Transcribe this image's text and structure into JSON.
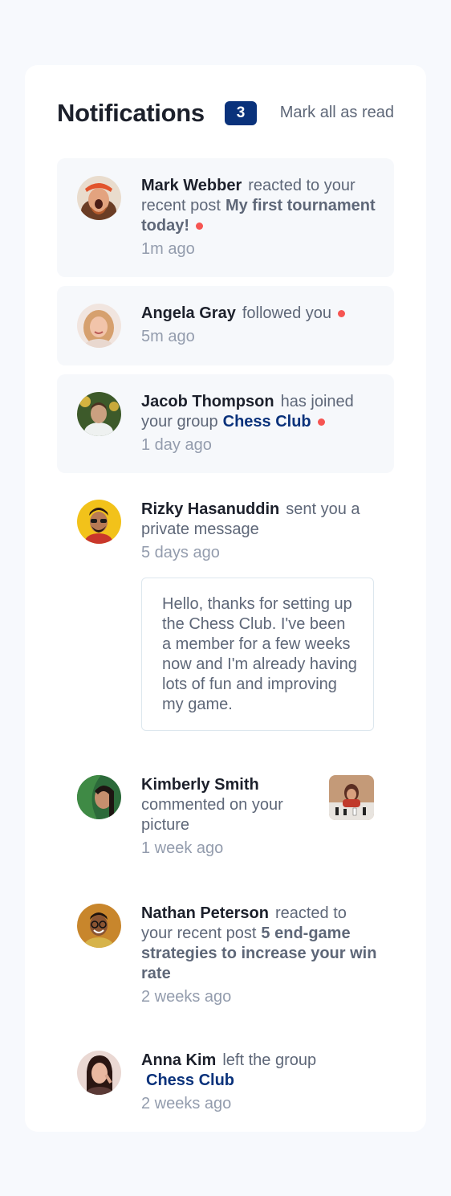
{
  "header": {
    "title": "Notifications",
    "badge_count": "3",
    "mark_all_label": "Mark all as read"
  },
  "notifications": [
    {
      "name": "Mark Webber",
      "action": "reacted to your recent post",
      "target": "My first tournament today!",
      "target_type": "post",
      "time": "1m ago",
      "unread": true
    },
    {
      "name": "Angela Gray",
      "action": "followed you",
      "target": "",
      "time": "5m ago",
      "unread": true
    },
    {
      "name": "Jacob Thompson",
      "action": "has joined your group",
      "target": "Chess Club",
      "target_type": "group",
      "time": "1 day ago",
      "unread": true
    },
    {
      "name": "Rizky Hasanuddin",
      "action": "sent you a private message",
      "target": "",
      "time": "5 days ago",
      "unread": false,
      "message": "Hello, thanks for setting up the Chess Club. I've been a member for a few weeks now and I'm already having lots of fun and improving my game."
    },
    {
      "name": "Kimberly Smith",
      "action": "commented on your picture",
      "target": "",
      "time": "1 week ago",
      "unread": false
    },
    {
      "name": "Nathan Peterson",
      "action": "reacted to your recent post",
      "target": "5 end-game strategies to increase your win rate",
      "target_type": "post",
      "time": "2 weeks ago",
      "unread": false
    },
    {
      "name": "Anna Kim",
      "action": "left the group",
      "target": "Chess Club",
      "target_type": "group",
      "time": "2 weeks ago",
      "unread": false
    }
  ],
  "colors": {
    "accent": "#0a327b",
    "unread_dot": "#f65552",
    "unread_bg": "#f6f8fb",
    "heading": "#1c202b",
    "body": "#5e6778",
    "muted": "#939cad"
  }
}
